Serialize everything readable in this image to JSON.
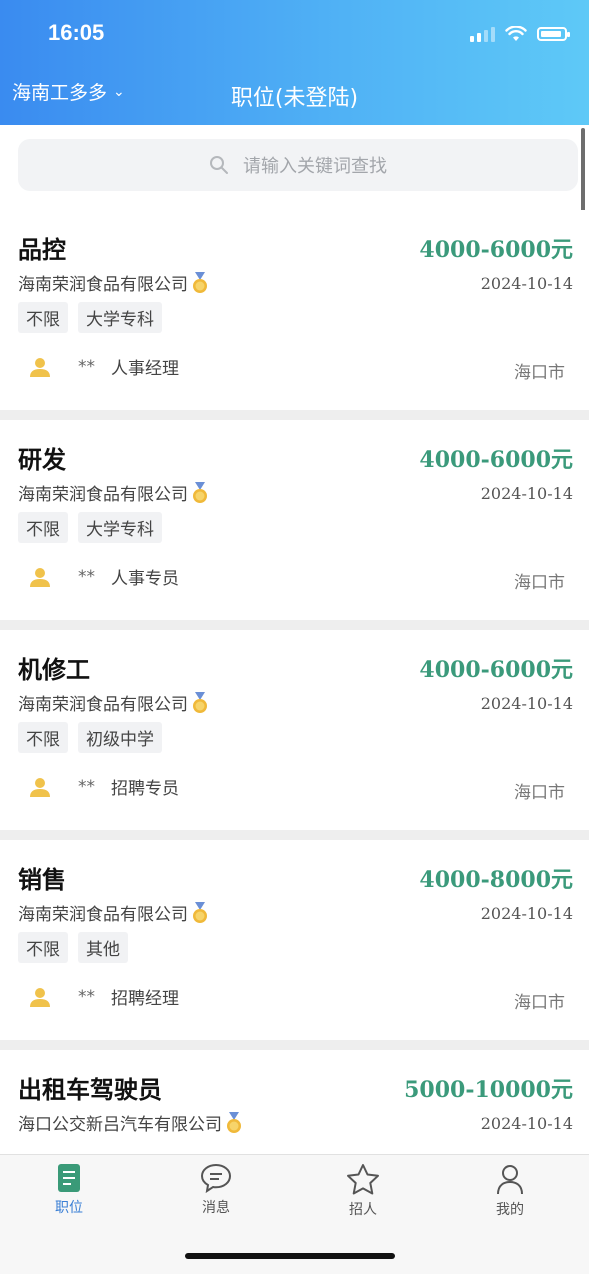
{
  "status_bar": {
    "time": "16:05"
  },
  "header": {
    "region": "海南工多多",
    "title": "职位(未登陆)"
  },
  "search": {
    "placeholder": "请输入关键词查找"
  },
  "jobs": [
    {
      "title": "品控",
      "salary": "4000-6000元",
      "company": "海南荣润食品有限公司",
      "date": "2024-10-14",
      "tags": [
        "不限",
        "大学专科"
      ],
      "contact_name": "**",
      "contact_role": "人事经理",
      "city": "海口市"
    },
    {
      "title": "研发",
      "salary": "4000-6000元",
      "company": "海南荣润食品有限公司",
      "date": "2024-10-14",
      "tags": [
        "不限",
        "大学专科"
      ],
      "contact_name": "**",
      "contact_role": "人事专员",
      "city": "海口市"
    },
    {
      "title": "机修工",
      "salary": "4000-6000元",
      "company": "海南荣润食品有限公司",
      "date": "2024-10-14",
      "tags": [
        "不限",
        "初级中学"
      ],
      "contact_name": "**",
      "contact_role": "招聘专员",
      "city": "海口市"
    },
    {
      "title": "销售",
      "salary": "4000-8000元",
      "company": "海南荣润食品有限公司",
      "date": "2024-10-14",
      "tags": [
        "不限",
        "其他"
      ],
      "contact_name": "**",
      "contact_role": "招聘经理",
      "city": "海口市"
    },
    {
      "title": "出租车驾驶员",
      "salary": "5000-10000元",
      "company": "海口公交新吕汽车有限公司",
      "date": "2024-10-14",
      "tags": [],
      "contact_name": "",
      "contact_role": "",
      "city": ""
    }
  ],
  "tabbar": {
    "items": [
      {
        "label": "职位",
        "icon": "job-list-icon"
      },
      {
        "label": "消息",
        "icon": "message-icon"
      },
      {
        "label": "招人",
        "icon": "star-icon"
      },
      {
        "label": "我的",
        "icon": "profile-icon"
      }
    ]
  },
  "colors": {
    "header_start": "#3a8bf0",
    "header_end": "#5ec9f7",
    "salary": "#3b9a7b",
    "active_tab": "#3a7fd5",
    "person_icon": "#f0c24b"
  }
}
